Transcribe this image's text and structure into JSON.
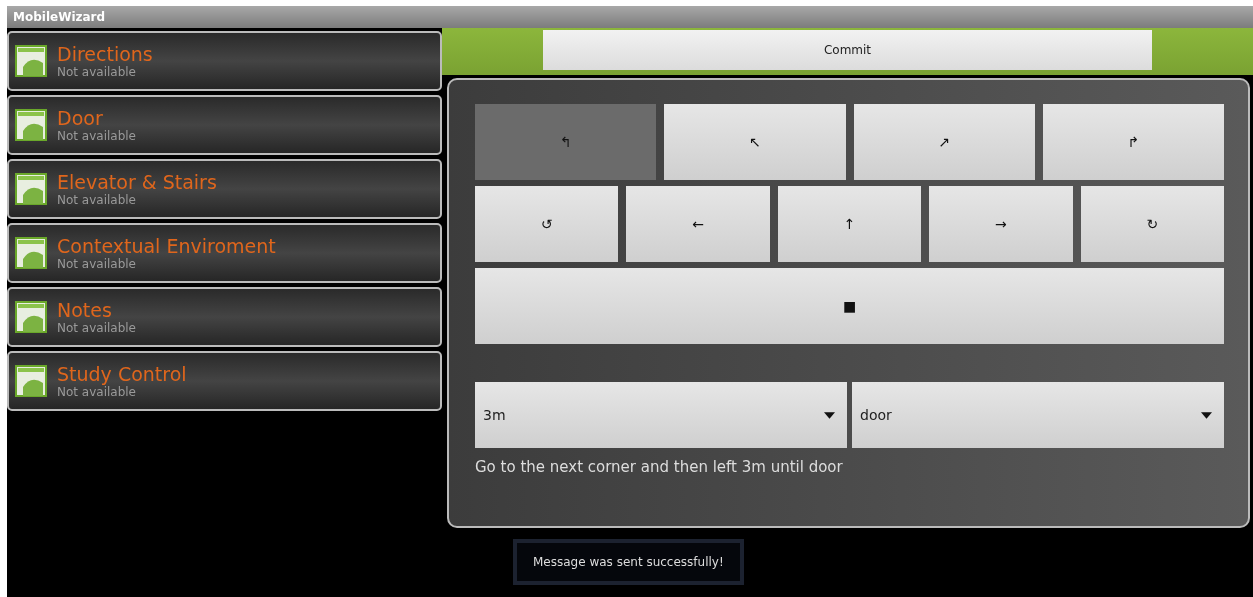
{
  "window": {
    "title": "MobileWizard"
  },
  "sidebar": {
    "items": [
      {
        "title": "Directions",
        "status": "Not available"
      },
      {
        "title": "Door",
        "status": "Not available"
      },
      {
        "title": "Elevator & Stairs",
        "status": "Not available"
      },
      {
        "title": "Contextual Enviroment",
        "status": "Not available"
      },
      {
        "title": "Notes",
        "status": "Not available"
      },
      {
        "title": "Study Control",
        "status": "Not available"
      }
    ]
  },
  "commit_button": "Commit",
  "direction_rows": [
    [
      {
        "label": "↰",
        "selected": true
      },
      {
        "label": "↖",
        "selected": false
      },
      {
        "label": "↗",
        "selected": false
      },
      {
        "label": "↱",
        "selected": false
      }
    ],
    [
      {
        "label": "↺",
        "selected": false
      },
      {
        "label": "←",
        "selected": false
      },
      {
        "label": "↑",
        "selected": false
      },
      {
        "label": "→",
        "selected": false
      },
      {
        "label": "↻",
        "selected": false
      }
    ],
    [
      {
        "label": "■",
        "selected": false
      }
    ]
  ],
  "dropdowns": [
    {
      "value": "3m"
    },
    {
      "value": "door"
    }
  ],
  "instruction": "Go to the next corner and then left 3m until door",
  "toast": "Message was sent successfully!"
}
